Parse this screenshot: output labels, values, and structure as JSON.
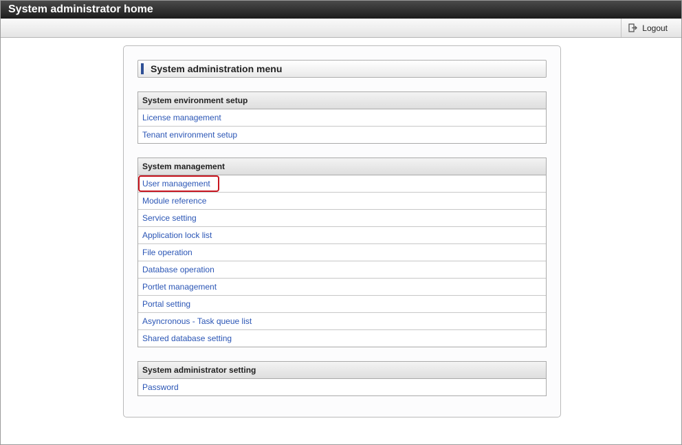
{
  "window": {
    "title": "System administrator home"
  },
  "toolbar": {
    "logout_label": "Logout",
    "logout_icon": "logout-icon"
  },
  "menu": {
    "heading": "System administration menu",
    "accent_color": "#2e4f95",
    "sections": [
      {
        "header": "System environment setup",
        "items": [
          "License management",
          "Tenant environment setup"
        ]
      },
      {
        "header": "System management",
        "items": [
          "User management",
          "Module reference",
          "Service setting",
          "Application lock list",
          "File operation",
          "Database operation",
          "Portlet management",
          "Portal setting",
          "Asyncronous - Task queue list",
          "Shared database setting"
        ]
      },
      {
        "header": "System administrator setting",
        "items": [
          "Password"
        ]
      }
    ]
  },
  "colors": {
    "link": "#2a55b5",
    "highlight": "#c8141e"
  }
}
